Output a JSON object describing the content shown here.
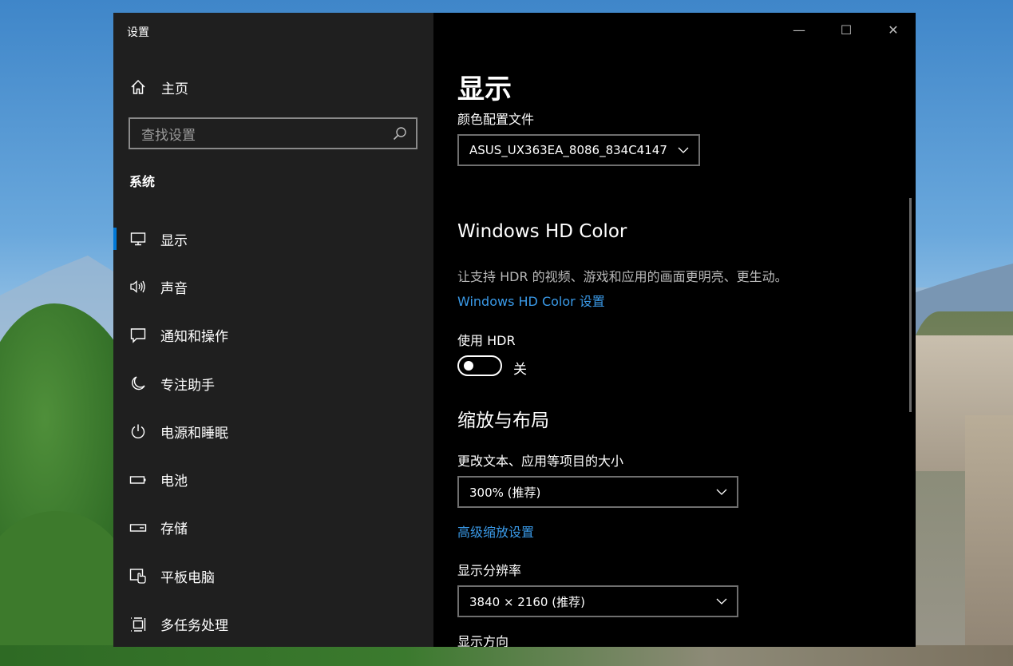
{
  "window": {
    "title": "设置",
    "controls": {
      "minimize": "—",
      "maximize": "☐",
      "close": "✕"
    }
  },
  "sidebar": {
    "home_label": "主页",
    "search_placeholder": "查找设置",
    "section_label": "系统",
    "items": [
      {
        "label": "显示",
        "icon": "monitor-icon",
        "active": true
      },
      {
        "label": "声音",
        "icon": "speaker-icon"
      },
      {
        "label": "通知和操作",
        "icon": "notification-icon"
      },
      {
        "label": "专注助手",
        "icon": "moon-icon"
      },
      {
        "label": "电源和睡眠",
        "icon": "power-icon"
      },
      {
        "label": "电池",
        "icon": "battery-icon"
      },
      {
        "label": "存储",
        "icon": "storage-icon"
      },
      {
        "label": "平板电脑",
        "icon": "tablet-icon"
      },
      {
        "label": "多任务处理",
        "icon": "multitasking-icon"
      }
    ]
  },
  "main": {
    "page_title": "显示",
    "color_profile": {
      "label": "颜色配置文件",
      "value": "ASUS_UX363EA_8086_834C4147"
    },
    "hd_color": {
      "heading": "Windows HD Color",
      "description": "让支持 HDR 的视频、游戏和应用的画面更明亮、更生动。",
      "link": "Windows HD Color 设置",
      "hdr_label": "使用 HDR",
      "hdr_state": "关"
    },
    "scale_layout": {
      "heading": "缩放与布局",
      "size_label": "更改文本、应用等项目的大小",
      "size_value": "300% (推荐)",
      "advanced_link": "高级缩放设置",
      "resolution_label": "显示分辨率",
      "resolution_value": "3840 × 2160 (推荐)",
      "orientation_label": "显示方向"
    }
  }
}
